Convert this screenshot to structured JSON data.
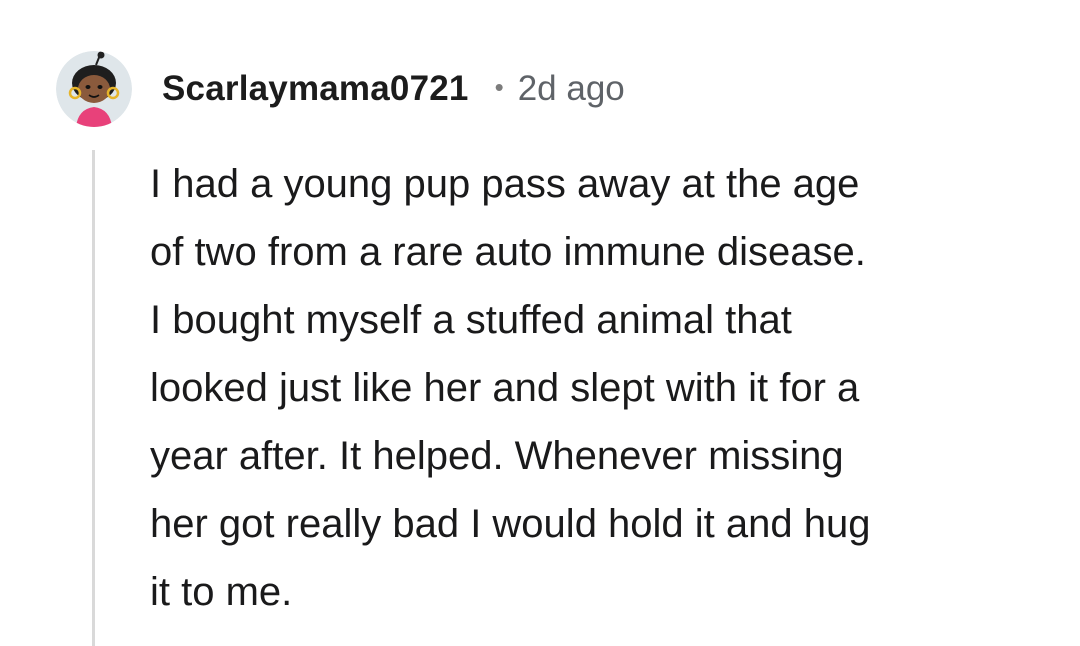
{
  "comment": {
    "author": "Scarlaymama0721",
    "separator": "•",
    "timestamp": "2d ago",
    "avatar_icon": "snoo-avatar-icon",
    "body_lines": [
      "I had a young pup pass away at the age",
      "of two from a rare auto immune disease.",
      "I bought myself a stuffed animal that",
      "looked just like her and slept with it for a",
      "year after. It helped. Whenever missing",
      "her got really bad I would hold it and hug",
      "it to me."
    ]
  },
  "colors": {
    "thread_line": "#d9d9d9",
    "text": "#1a1a1b",
    "meta": "#5f6368"
  }
}
